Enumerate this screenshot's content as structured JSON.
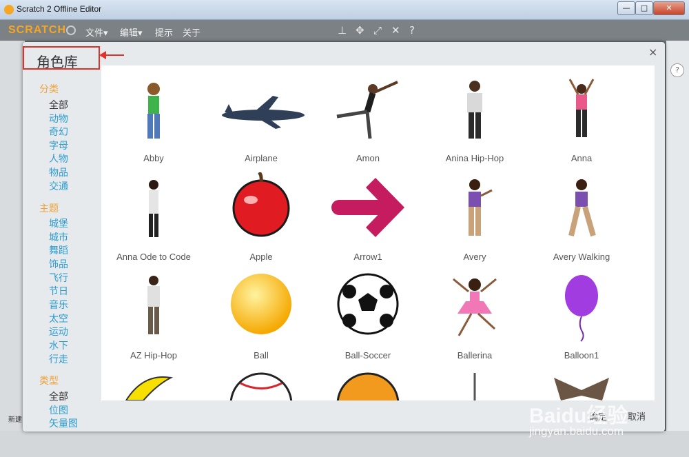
{
  "window": {
    "title": "Scratch 2 Offline Editor",
    "minimize": "—",
    "maximize": "□",
    "close": "✕"
  },
  "menubar": {
    "logo": "SCRATCH",
    "items": [
      "文件▾",
      "编辑▾",
      "提示",
      "关于"
    ]
  },
  "toolbar_icons": [
    "stamp-icon",
    "move-icon",
    "grow-icon",
    "shrink-icon",
    "help-icon"
  ],
  "background": {
    "help": "?",
    "new_label": "新建"
  },
  "dialog": {
    "title": "角色库",
    "close": "×",
    "sections": [
      {
        "heading": "分类",
        "items": [
          "全部",
          "动物",
          "奇幻",
          "字母",
          "人物",
          "物品",
          "交通"
        ],
        "selected": 0
      },
      {
        "heading": "主题",
        "items": [
          "城堡",
          "城市",
          "舞蹈",
          "饰品",
          "飞行",
          "节日",
          "音乐",
          "太空",
          "运动",
          "水下",
          "行走"
        ],
        "selected": -1
      },
      {
        "heading": "类型",
        "items": [
          "全部",
          "位图",
          "矢量图"
        ],
        "selected": 0
      }
    ],
    "sprites": [
      "Abby",
      "Airplane",
      "Amon",
      "Anina Hip-Hop",
      "Anna",
      "Anna Ode to Code",
      "Apple",
      "Arrow1",
      "Avery",
      "Avery Walking",
      "AZ Hip-Hop",
      "Ball",
      "Ball-Soccer",
      "Ballerina",
      "Balloon1"
    ],
    "buttons": {
      "ok": "确定",
      "cancel": "取消"
    }
  },
  "watermark": {
    "brand": "Baidu经验",
    "url": "jingyan.baidu.com"
  },
  "colors": {
    "accent_red": "#e0312a",
    "category_heading": "#f0a23a",
    "category_link": "#2a9bd1"
  }
}
